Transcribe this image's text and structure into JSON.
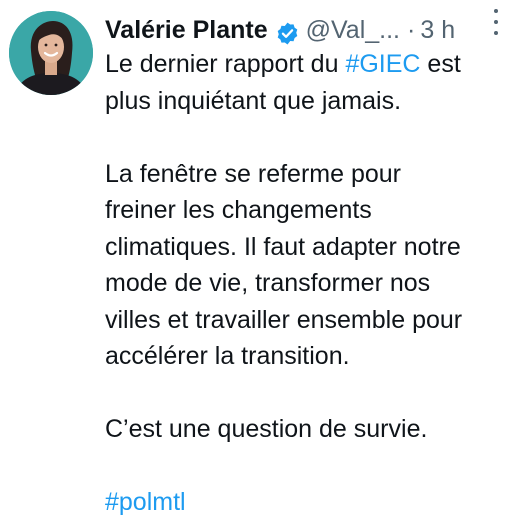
{
  "author": {
    "name": "Valérie Plante",
    "handle": "@Val_...",
    "separator": "·",
    "time": "3 h",
    "avatar_bg": "#3aa7a7",
    "verified_color": "#1d9bf0"
  },
  "icons": {
    "verified": "verified-badge-icon",
    "more": "more-options-icon"
  },
  "tweet": {
    "line1_prefix": "Le dernier rapport du ",
    "line1_hashtag": "#GIEC",
    "line1_suffix": " est",
    "line2": "plus inquiétant que jamais.",
    "line3": "La fenêtre se referme pour",
    "line4": "freiner les changements",
    "line5": "climatiques. Il faut adapter notre",
    "line6": "mode de vie, transformer nos",
    "line7": "villes et travailler ensemble pour",
    "line8": "accélérer la transition.",
    "line9": "C’est une question de survie.",
    "hashtag_final": "#polmtl"
  },
  "colors": {
    "text": "#0f1419",
    "secondary": "#536471",
    "link": "#1d9bf0"
  }
}
